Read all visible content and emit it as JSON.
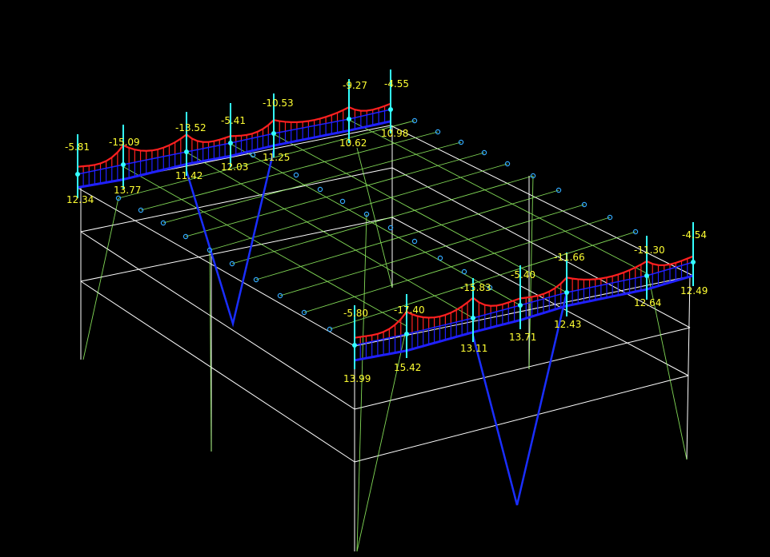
{
  "colors": {
    "background": "#000000",
    "frame": "#ffffff",
    "deflected_shape": "#99ff66",
    "negative_diagram": "#ff2020",
    "positive_diagram": "#2020ff",
    "column_marker": "#33ffff",
    "node": "#33aaff",
    "diagonal_brace": "#1a2eff",
    "label": "#ffff33"
  },
  "left_beam_labels": {
    "top": [
      "-5.81",
      "-15.09",
      "-13.52",
      "-5.41",
      "-10.53",
      "-9.27",
      "-4.55"
    ],
    "bottom": [
      "12.34",
      "13.77",
      "11.42",
      "12.03",
      "11.25",
      "10.62",
      "10.98"
    ]
  },
  "right_beam_labels": {
    "top": [
      "-5.80",
      "-17.40",
      "-15.83",
      "-5.40",
      "-11.66",
      "-11.30",
      "-4.54"
    ],
    "bottom": [
      "13.99",
      "15.42",
      "13.11",
      "13.71",
      "12.43",
      "12.64",
      "12.49"
    ]
  }
}
